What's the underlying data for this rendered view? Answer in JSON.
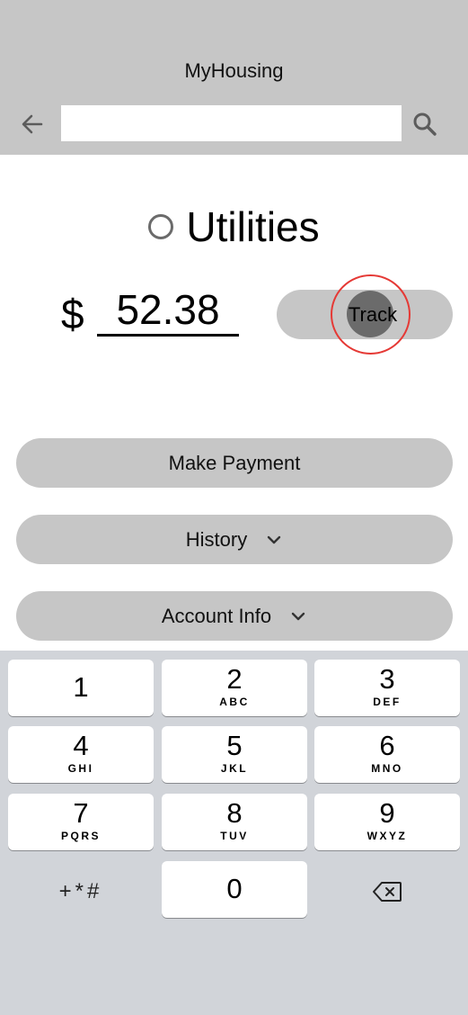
{
  "header": {
    "title": "MyHousing",
    "search_placeholder": "",
    "background_color": "#c6c6c6"
  },
  "category": {
    "label": "Utilities",
    "selected": false
  },
  "amount": {
    "currency_symbol": "$",
    "value": "52.38"
  },
  "track_button": {
    "label": "Track"
  },
  "actions": {
    "make_payment": "Make Payment",
    "history": "History",
    "account_info": "Account Info"
  },
  "keypad": {
    "keys": [
      {
        "num": "1",
        "letters": ""
      },
      {
        "num": "2",
        "letters": "ABC"
      },
      {
        "num": "3",
        "letters": "DEF"
      },
      {
        "num": "4",
        "letters": "GHI"
      },
      {
        "num": "5",
        "letters": "JKL"
      },
      {
        "num": "6",
        "letters": "MNO"
      },
      {
        "num": "7",
        "letters": "PQRS"
      },
      {
        "num": "8",
        "letters": "TUV"
      },
      {
        "num": "9",
        "letters": "WXYZ"
      },
      {
        "num": "0",
        "letters": ""
      }
    ],
    "symbols_label": "+*#",
    "backspace_icon": "backspace-icon"
  },
  "icons": {
    "back": "arrow-left-icon",
    "search": "search-icon",
    "chevron": "chevron-down-icon",
    "touch_indicator_color": "#e53935"
  }
}
